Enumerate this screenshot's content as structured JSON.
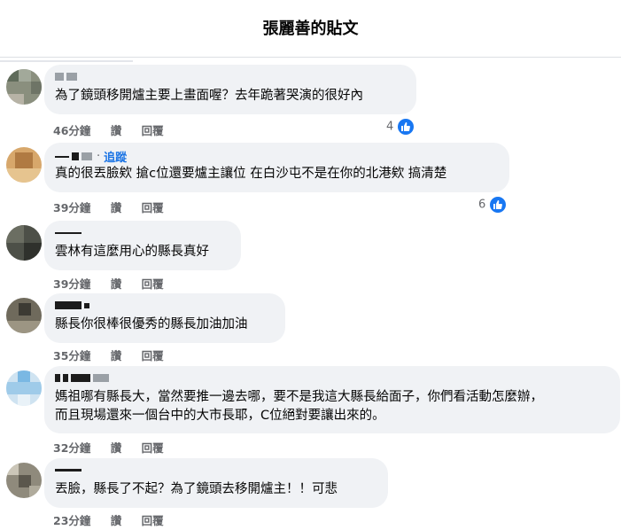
{
  "header": {
    "title": "張麗善的貼文"
  },
  "comments": [
    {
      "text": "為了鏡頭移開爐主要上畫面喔？去年跪著哭演的很好內",
      "time": "46分鐘",
      "like": "讚",
      "reply": "回覆",
      "reactions": "4",
      "follow": ""
    },
    {
      "text": "真的很丟臉欸 搶c位還要爐主讓位 在白沙屯不是在你的北港欸 搞清楚",
      "time": "39分鐘",
      "like": "讚",
      "reply": "回覆",
      "reactions": "6",
      "follow": "追蹤"
    },
    {
      "text": "雲林有這麼用心的縣長真好",
      "time": "39分鐘",
      "like": "讚",
      "reply": "回覆",
      "reactions": "",
      "follow": ""
    },
    {
      "text": "縣長你很棒很優秀的縣長加油加油",
      "time": "35分鐘",
      "like": "讚",
      "reply": "回覆",
      "reactions": "",
      "follow": ""
    },
    {
      "text": "媽祖哪有縣長大，當然要推一邊去哪，要不是我這大縣長給面子，你們看活動怎麼辦，",
      "text2": "而且現場還來一個台中的大市長耶，C位絕對要讓出來的。",
      "time": "32分鐘",
      "like": "讚",
      "reply": "回覆",
      "reactions": "",
      "follow": ""
    },
    {
      "text": "丟臉，縣長了不起？為了鏡頭去移開爐主！！可悲",
      "time": "23分鐘",
      "like": "讚",
      "reply": "回覆",
      "reactions": "",
      "follow": ""
    }
  ],
  "icons": {
    "like": "thumbs-up-icon"
  },
  "colors": {
    "accent": "#1877f2",
    "bubble": "#f0f2f5",
    "meta": "#65676b"
  }
}
